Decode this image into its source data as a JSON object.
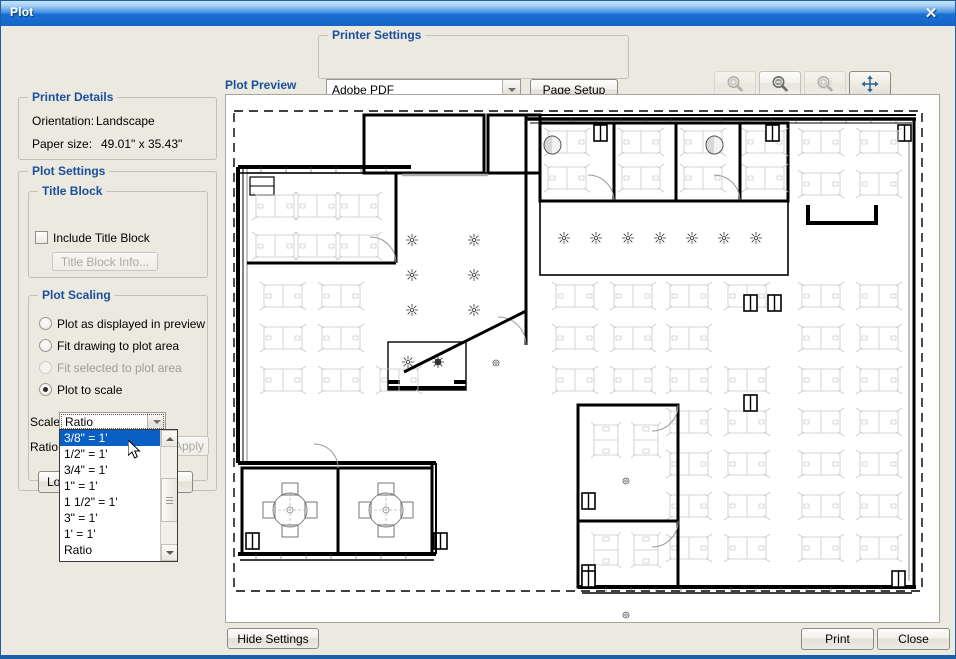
{
  "window": {
    "title": "Plot",
    "close_label": "✕"
  },
  "printer_settings": {
    "legend": "Printer Settings",
    "printer_value": "Adobe PDF",
    "page_setup_label": "Page Setup"
  },
  "toolbar": {
    "zoom_in": "zoom-in",
    "zoom_out": "zoom-out",
    "zoom_window": "zoom-window",
    "pan": "pan"
  },
  "printer_details": {
    "legend": "Printer Details",
    "orientation_label": "Orientation:",
    "orientation_value": "Landscape",
    "paper_label": "Paper size:",
    "paper_value": "49.01\" x 35.43\""
  },
  "plot_settings": {
    "legend": "Plot Settings",
    "title_block": {
      "legend": "Title Block",
      "include_label": "Include Title Block",
      "include_checked": false,
      "info_button": "Title Block Info..."
    },
    "plot_scaling": {
      "legend": "Plot Scaling",
      "options": [
        {
          "label": "Plot as displayed in preview",
          "selected": false,
          "disabled": false
        },
        {
          "label": "Fit drawing to plot area",
          "selected": false,
          "disabled": false
        },
        {
          "label": "Fit selected to plot area",
          "selected": false,
          "disabled": true
        },
        {
          "label": "Plot to scale",
          "selected": true,
          "disabled": false
        }
      ],
      "scale_label": "Scale:",
      "scale_value": "Ratio",
      "ratio_label": "Ratio:",
      "apply_label": "Apply",
      "profile_button": "Load Plot Profile...",
      "dropdown_open": true,
      "dropdown_items": [
        "3/8\" = 1'",
        "1/2\" = 1'",
        "3/4\" = 1'",
        "1\" = 1'",
        "1 1/2\" = 1'",
        "3\" = 1'",
        "1' = 1'",
        "Ratio"
      ],
      "dropdown_selected_index": 0
    }
  },
  "preview": {
    "title": "Plot Preview"
  },
  "footer": {
    "hide_settings": "Hide Settings",
    "print": "Print",
    "close": "Close"
  },
  "colors": {
    "accent_blue": "#1a4f9c",
    "titlebar_blue": "#1565c8",
    "selection_blue": "#0a5fc4",
    "dialog_bg": "#ece9e0"
  }
}
